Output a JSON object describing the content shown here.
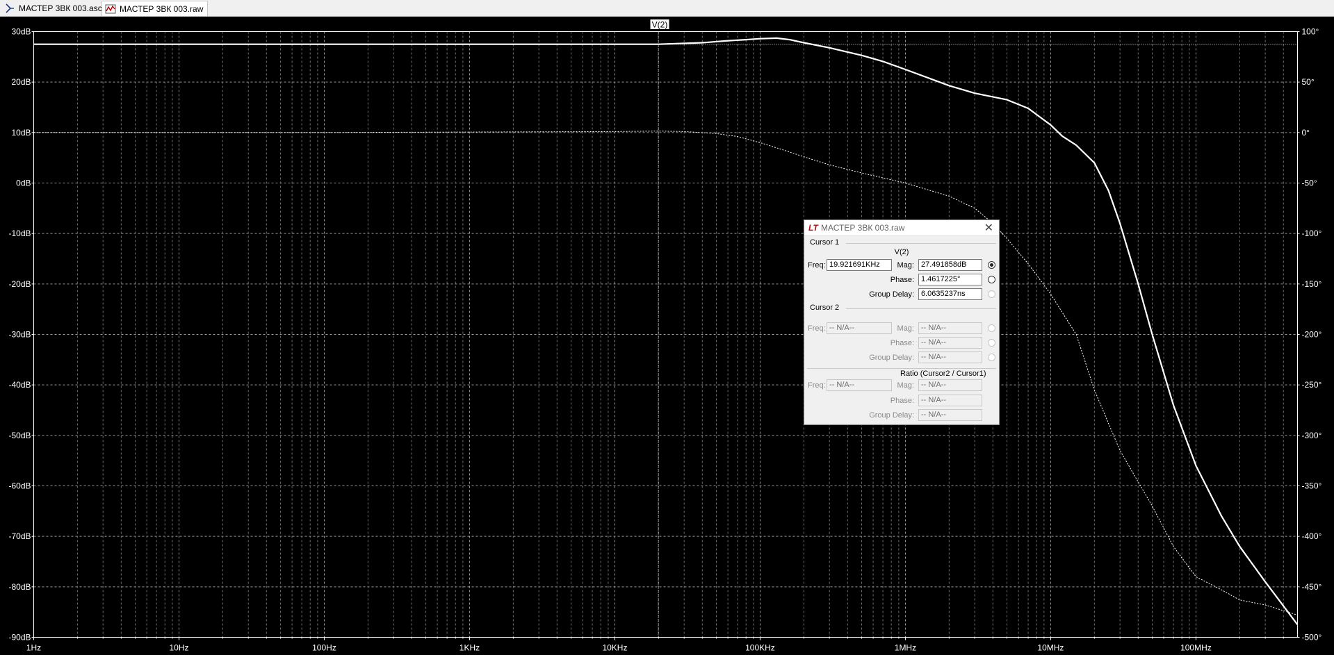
{
  "tabs": [
    {
      "label": "МАСТЕР 3ВК 003.asc",
      "icon": "schematic-icon",
      "active": false
    },
    {
      "label": "МАСТЕР 3ВК 003.raw",
      "icon": "waveform-icon",
      "active": true
    }
  ],
  "chart_data": {
    "type": "line",
    "title": "V(2)",
    "x_scale": "log",
    "xlim": [
      1,
      500000000
    ],
    "x_ticks": [
      "1Hz",
      "10Hz",
      "100Hz",
      "1KHz",
      "10KHz",
      "100KHz",
      "1MHz",
      "10MHz",
      "100MHz"
    ],
    "y_left_ticks": [
      "30dB",
      "20dB",
      "10dB",
      "0dB",
      "-10dB",
      "-20dB",
      "-30dB",
      "-40dB",
      "-50dB",
      "-60dB",
      "-70dB",
      "-80dB",
      "-90dB"
    ],
    "y_left_lim": [
      -90,
      30
    ],
    "y_right_ticks": [
      "100°",
      "50°",
      "0°",
      "-50°",
      "-100°",
      "-150°",
      "-200°",
      "-250°",
      "-300°",
      "-350°",
      "-400°",
      "-450°",
      "-500°"
    ],
    "y_right_lim": [
      -500,
      100
    ],
    "grid": true,
    "cursor_x": 19921.691,
    "series": [
      {
        "axis": "left",
        "style": "solid",
        "x": [
          1,
          10,
          100,
          1000,
          10000,
          20000,
          40000,
          60000,
          80000,
          100000,
          130000,
          160000,
          200000,
          300000,
          500000,
          700000,
          1000000,
          2000000,
          3000000,
          5000000,
          7000000,
          10000000,
          12000000,
          15000000,
          20000000,
          25000000,
          30000000,
          40000000,
          50000000,
          70000000,
          100000000,
          150000000,
          200000000,
          300000000,
          500000000
        ],
        "values": [
          27.49,
          27.49,
          27.49,
          27.49,
          27.5,
          27.5,
          27.8,
          28.2,
          28.4,
          28.6,
          28.7,
          28.4,
          27.8,
          26.8,
          25.3,
          24.1,
          22.5,
          19.3,
          17.8,
          16.5,
          14.8,
          11.5,
          9.3,
          7.5,
          4.0,
          -1.5,
          -8.0,
          -20.0,
          -30.0,
          -44.0,
          -56.0,
          -66.0,
          -72.0,
          -79.0,
          -87.5
        ]
      },
      {
        "axis": "right",
        "style": "dashed",
        "x": [
          1,
          10,
          100,
          1000,
          10000,
          20000,
          30000,
          50000,
          70000,
          100000,
          150000,
          200000,
          300000,
          500000,
          1000000,
          2000000,
          3000000,
          4000000,
          5000000,
          7000000,
          10000000,
          15000000,
          20000000,
          30000000,
          50000000,
          70000000,
          100000000,
          150000000,
          200000000,
          300000000,
          500000000
        ],
        "values": [
          0,
          0,
          0,
          0.5,
          1.0,
          1.46,
          1.0,
          -1.0,
          -4.0,
          -10.0,
          -18.0,
          -24.0,
          -32.0,
          -40.0,
          -50.0,
          -63.0,
          -75.0,
          -90.0,
          -105.0,
          -130.0,
          -160.0,
          -200.0,
          -255.0,
          -315.0,
          -370.0,
          -410.0,
          -440.0,
          -453.0,
          -463.0,
          -468.0,
          -478.0
        ]
      }
    ]
  },
  "dialog": {
    "title": "МАСТЕР 3ВК 003.raw",
    "logo": "LT",
    "cursor1": {
      "label": "Cursor 1",
      "trace": "V(2)",
      "freq_label": "Freq:",
      "freq": "19.921691KHz",
      "mag_label": "Mag:",
      "mag": "27.491858dB",
      "phase_label": "Phase:",
      "phase": "1.4617225°",
      "gd_label": "Group Delay:",
      "gd": "6.0635237ns"
    },
    "cursor2": {
      "label": "Cursor 2",
      "freq_label": "Freq:",
      "freq": "-- N/A--",
      "mag_label": "Mag:",
      "mag": "-- N/A--",
      "phase_label": "Phase:",
      "phase": "-- N/A--",
      "gd_label": "Group Delay:",
      "gd": "-- N/A--"
    },
    "ratio": {
      "label": "Ratio (Cursor2 / Cursor1)",
      "freq_label": "Freq:",
      "freq": "-- N/A--",
      "mag_label": "Mag:",
      "mag": "-- N/A--",
      "phase_label": "Phase:",
      "phase": "-- N/A--",
      "gd_label": "Group Delay:",
      "gd": "-- N/A--"
    }
  }
}
